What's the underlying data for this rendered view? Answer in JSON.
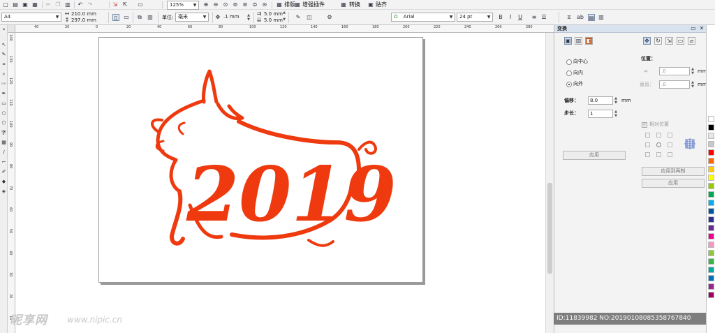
{
  "toolbar": {
    "zoom": "125%",
    "menu_arrange": "排版",
    "menu_plugins": "增强插件",
    "menu_convert": "转换",
    "menu_paste": "贴齐",
    "page_size": "A4",
    "page_width": "210.0 mm",
    "page_height": "297.0 mm",
    "unit_label": "单位:",
    "unit_value": "毫米",
    "nudge": ".1 mm",
    "dup_x": "5.0 mm",
    "dup_y": "5.0 mm",
    "font_name": "Arial",
    "font_size": "24 pt"
  },
  "ruler": {
    "h_labels": [
      "40",
      "20",
      "0",
      "20",
      "40",
      "60",
      "80",
      "100",
      "120",
      "140",
      "160",
      "180",
      "200",
      "220",
      "240",
      "260",
      "280"
    ],
    "v_labels": [
      "140",
      "130",
      "120",
      "110",
      "100",
      "90",
      "80",
      "70",
      "60",
      "50",
      "40",
      "30",
      "20",
      "10"
    ]
  },
  "artwork": {
    "text": "2019",
    "color": "#ee3a0e"
  },
  "docker": {
    "title": "变换",
    "opt_center": "向中心",
    "opt_inside": "向内",
    "opt_outside": "向外",
    "selected_option": "向外",
    "offset_label": "偏移：",
    "offset_value": "8.0",
    "offset_unit": "mm",
    "steps_label": "步长：",
    "steps_value": "1",
    "apply_left": "应用",
    "position_label": "位置：",
    "x_value": ".0",
    "y_label": "垂直：",
    "y_value": ".0",
    "unit_mm": "mm",
    "relative_label": "相对位置",
    "apply_to_dup": "应用到再制",
    "apply_right": "应用"
  },
  "watermark": {
    "brand": "昵享网",
    "url": "www.nipic.cn",
    "id_text": "ID:11839982 NO:20190108085358767840"
  },
  "palette": [
    "#ffffff",
    "#000000",
    "#e6e6e6",
    "#c8c8c8",
    "#ff0000",
    "#ff6600",
    "#ffcc00",
    "#ffff00",
    "#99cc00",
    "#00a651",
    "#00aeef",
    "#0054a6",
    "#2e3192",
    "#662d91",
    "#ec008c",
    "#f49ac1",
    "#8dc63f",
    "#39b54a",
    "#00a99d",
    "#0072bc",
    "#92278f",
    "#9e005d"
  ]
}
